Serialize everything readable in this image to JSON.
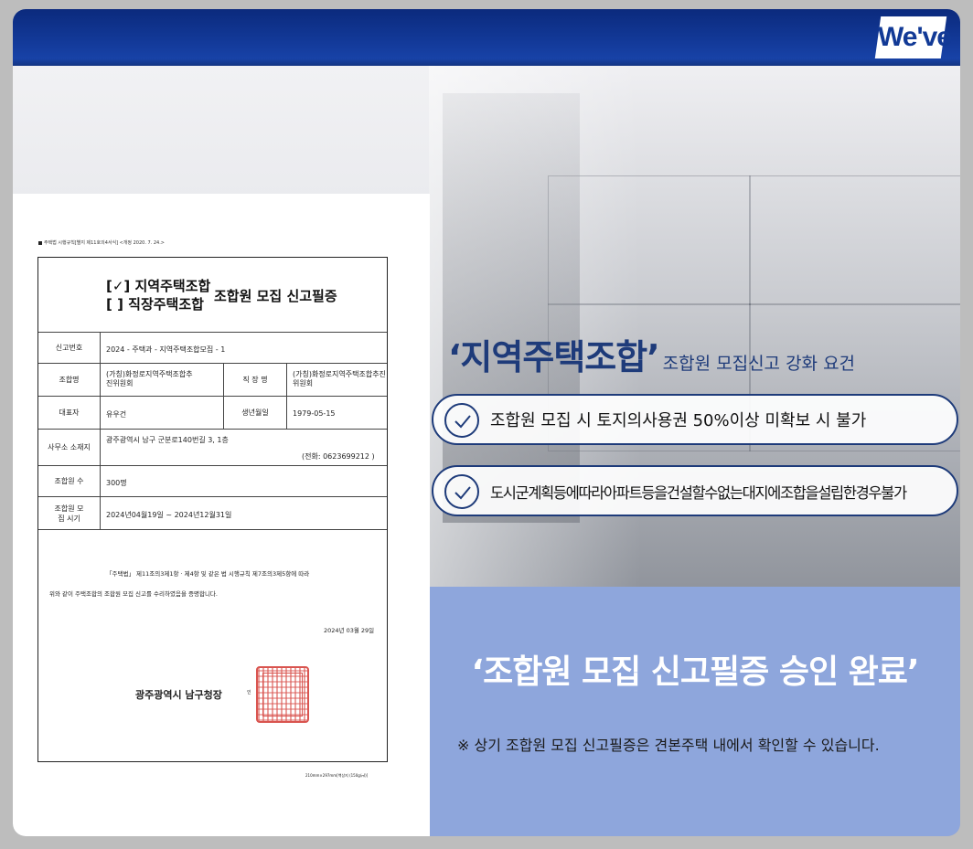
{
  "brand": {
    "logo_text": "We've"
  },
  "certificate": {
    "header_note": "주택법 시행규칙[별지 제11호의4서식] <개정 2020. 7. 24.>",
    "title_option1": "[✓] 지역주택조합",
    "title_option2": "[ ] 직장주택조합",
    "title_main": "조합원 모집 신고필증",
    "rows": {
      "report_no_label": "신고번호",
      "report_no": "2024 - 주택과 - 지역주택조합모집 - 1",
      "union_label": "조합명",
      "union_name": "(가칭)화정로지역주택조합추진위원회",
      "workplace_label": "직 장 명",
      "workplace_name": "(가칭)화정로지역주택조합추진위원회",
      "rep_label": "대표자",
      "rep_name": "유우건",
      "birth_label": "생년월일",
      "birth": "1979-05-15",
      "office_label": "사무소 소재지",
      "office_addr": "광주광역시 남구 군분로140번길 3, 1층",
      "office_tel": "(전화:  0623699212 )",
      "members_label": "조합원 수",
      "members": "300명",
      "period_label": "조합원 모집 시기",
      "period": "2024년04월19일 ~ 2024년12월31일"
    },
    "body_line1": "「주택법」 제11조의3제1항 · 제4항 및 같은 법 시행규칙 제7조의3제5항에 따라",
    "body_line2": "위와 같이 주택조합의 조합원 모집 신고를 수리하였음을 증명합니다.",
    "date": "2024년 03월 29일",
    "issuer": "광주광역시 남구청장",
    "seal_mark": "인",
    "paper_size": "210mm×297mm[백상지 (150g/㎡)]"
  },
  "headline": {
    "highlight": "‘지역주택조합’",
    "rest": "조합원 모집신고 강화 요건"
  },
  "requirements": [
    "조합원 모집 시 토지의사용권 50%이상 미확보 시 불가",
    "도시군계획등에따라아파트등을건설할수없는대지에조합을설립한경우불가"
  ],
  "approval": {
    "title": "‘조합원 모집 신고필증 승인 완료’",
    "note": "※ 상기 조합원 모집 신고필증은 견본주택 내에서 확인할 수 있습니다."
  },
  "colors": {
    "navy": "#1e3b7a",
    "top_band": "#133a9a",
    "panel_blue": "#8ea6dc",
    "seal_red": "#d9544f"
  }
}
